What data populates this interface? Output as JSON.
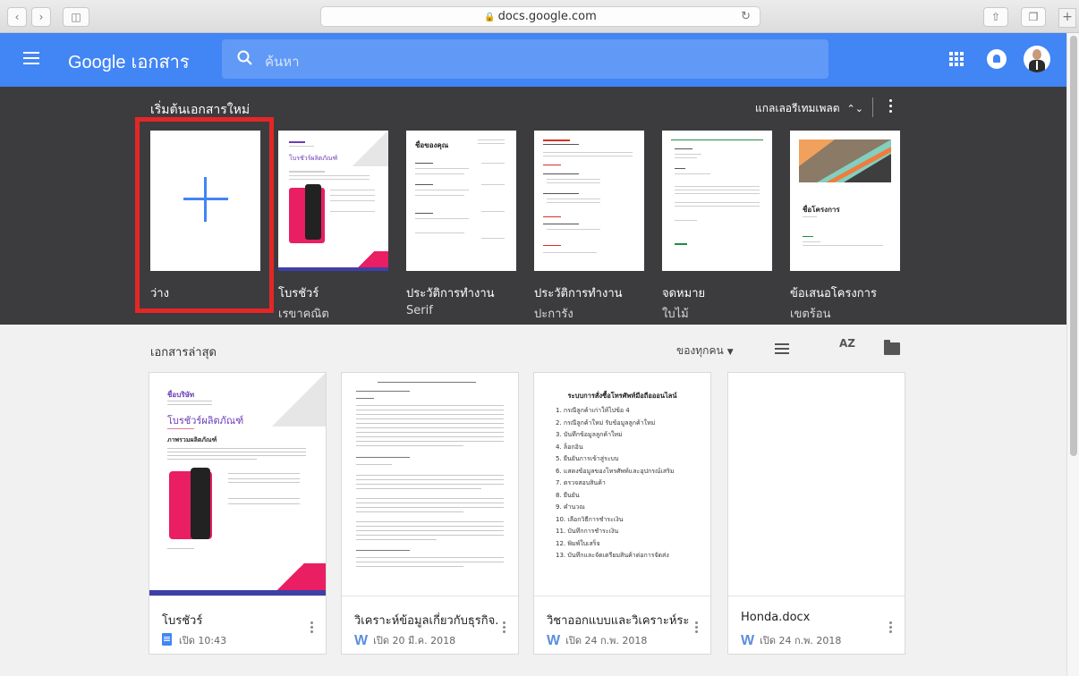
{
  "browser": {
    "url": "docs.google.com"
  },
  "header": {
    "brand_google": "Google",
    "brand_app": "เอกสาร",
    "search_placeholder": "ค้นหา"
  },
  "gallery": {
    "title": "เริ่มต้นเอกสารใหม่",
    "gallery_button": "แกลเลอรีเทมเพลต",
    "templates": [
      {
        "name": "ว่าง",
        "subtitle": ""
      },
      {
        "name": "โบรชัวร์",
        "subtitle": "เรขาคณิต"
      },
      {
        "name": "ประวัติการทำงาน",
        "subtitle": "Serif"
      },
      {
        "name": "ประวัติการทำงาน",
        "subtitle": "ปะการัง"
      },
      {
        "name": "จดหมาย",
        "subtitle": "ใบไม้"
      },
      {
        "name": "ข้อเสนอโครงการ",
        "subtitle": "เขตร้อน"
      }
    ],
    "brochure_thumb_title": "โบรชัวร์ผลิตภัณฑ์",
    "resume_thumb_title": "ชื่อของคุณ",
    "proposal_thumb_title": "ชื่อโครงการ"
  },
  "recent": {
    "title": "เอกสารล่าสุด",
    "owner_filter": "ของทุกคน",
    "sort_label": "AZ",
    "docs": [
      {
        "title": "โบรชัวร์",
        "opened": "เปิด 10:43",
        "type": "docs"
      },
      {
        "title": "วิเคราะห์ข้อมูลเกี่ยวกับธุรกิจ...",
        "opened": "เปิด 20 มี.ค. 2018",
        "type": "word"
      },
      {
        "title": "วิชาออกแบบและวิเคราะห์ระ...",
        "opened": "เปิด 24 ก.พ. 2018",
        "type": "word"
      },
      {
        "title": "Honda.docx",
        "opened": "เปิด 24 ก.พ. 2018",
        "type": "word"
      }
    ],
    "word_badge": "W",
    "brochure_preview": {
      "company": "ชื่อบริษัท",
      "title": "โบรชัวร์ผลิตภัณฑ์",
      "section": "ภาพรวมผลิตภัณฑ์"
    },
    "doc3_preview": {
      "heading": "ระบบการสั่งซื้อโทรศัพท์มือถือออนไลน์",
      "items": [
        "1. กรณีลูกค้าเก่าให้ไปข้อ 4",
        "2. กรณีลูกค้าใหม่ รับข้อมูลลูกค้าใหม่",
        "3. บันทึกข้อมูลลูกค้าใหม่",
        "4. ล็อกอิน",
        "5. ยืนยันการเข้าสู่ระบบ",
        "6. แสดงข้อมูลของโทรศัพท์และอุปกรณ์เสริม",
        "7. ตรวจสอบสินค้า",
        "8. ยืนยัน",
        "9. คำนวณ",
        "10. เลือกวิธีการชำระเงิน",
        "11. บันทึกการชำระเงิน",
        "12. พิมพ์ใบเสร็จ",
        "13. บันทึกและจัดเตรียมสินค้าต่อการจัดส่ง"
      ]
    }
  }
}
